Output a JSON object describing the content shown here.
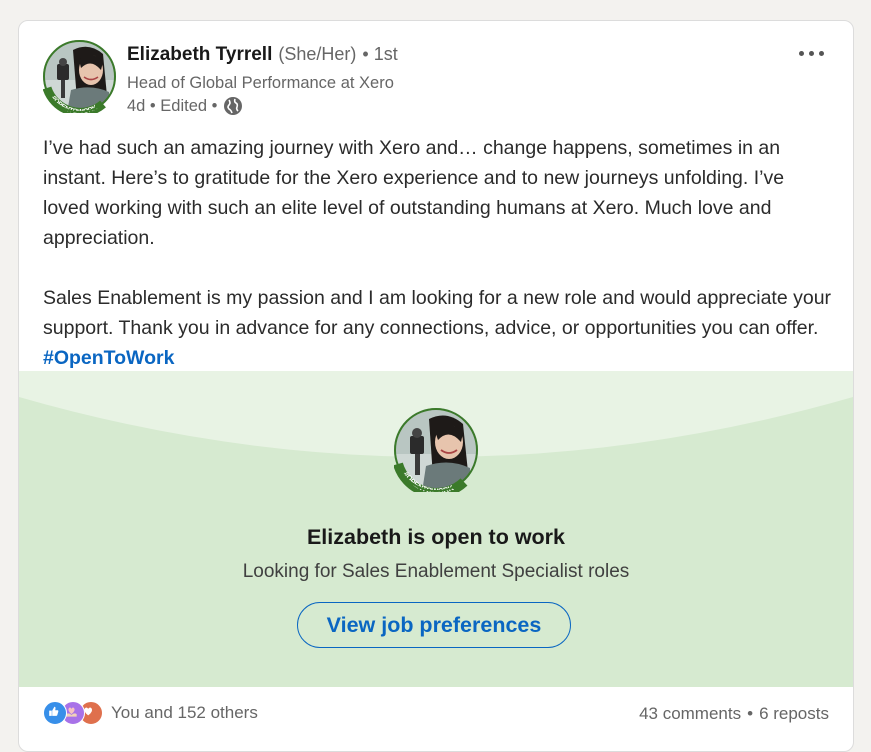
{
  "post": {
    "author": {
      "name": "Elizabeth Tyrrell",
      "pronouns": "(She/Her)",
      "degree": "• 1st",
      "headline": "Head of Global Performance at Xero",
      "meta_time": "4d • Edited •",
      "avatar_badge": "#OPENTOWORK"
    },
    "body": {
      "para1": "I’ve had such an amazing journey with Xero and… change happens, sometimes in an instant. Here’s to gratitude for the Xero experience and to new journeys unfolding. I’ve loved working with such an elite level of outstanding humans at Xero. Much love and appreciation.",
      "para2": "Sales Enablement is my passion and I am looking for a new role and would appreciate your support. Thank you in advance for any connections, advice, or opportunities you can offer.",
      "hashtag": "#OpenToWork"
    },
    "open_to_work": {
      "title": "Elizabeth is open to work",
      "subtitle": "Looking for Sales Enablement Specialist roles",
      "button_label": "View job preferences"
    },
    "social": {
      "reactions_text": "You and 152 others",
      "comments": "43 comments",
      "separator": "•",
      "reposts": "6 reposts",
      "reaction_icons": [
        "like-icon",
        "support-icon",
        "love-icon"
      ]
    }
  },
  "colors": {
    "accent": "#0a66c2",
    "banner_bg": "#d6ead0",
    "otw_green": "#3b7a2a",
    "page_bg": "#f3f2ef"
  }
}
